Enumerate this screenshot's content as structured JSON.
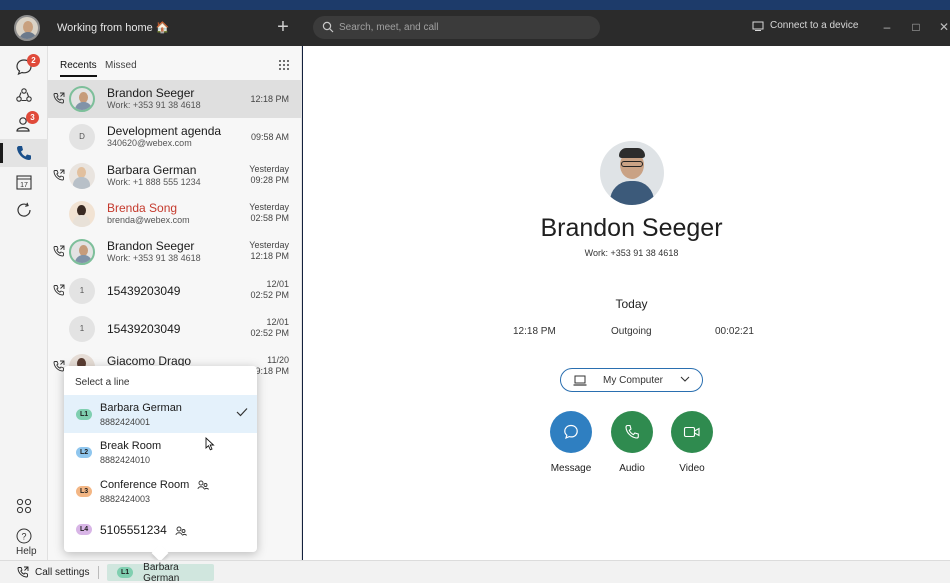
{
  "titlebar": {
    "status": "Working from home 🏠",
    "search_placeholder": "Search, meet, and call",
    "connect_label": "Connect to a device"
  },
  "rail": {
    "messaging_badge": "2",
    "contacts_badge": "3",
    "help_label": "Help"
  },
  "tabs": {
    "recents": "Recents",
    "missed": "Missed"
  },
  "calls": [
    {
      "name": "Brandon Seeger",
      "sub": "Work: +353 91 38 4618",
      "time": "12:18 PM"
    },
    {
      "name": "Development agenda",
      "sub": "340620@webex.com",
      "time": "09:58 AM",
      "initial": "D"
    },
    {
      "name": "Barbara German",
      "sub": "Work: +1 888 555 1234",
      "date": "Yesterday",
      "time": "09:28 PM"
    },
    {
      "name": "Brenda Song",
      "sub": "brenda@webex.com",
      "date": "Yesterday",
      "time": "02:58 PM"
    },
    {
      "name": "Brandon Seeger",
      "sub": "Work: +353 91 38 4618",
      "date": "Yesterday",
      "time": "12:18 PM"
    },
    {
      "name": "15439203049",
      "date": "12/01",
      "time": "02:52 PM",
      "initial": "1"
    },
    {
      "name": "15439203049",
      "date": "12/01",
      "time": "02:52 PM",
      "initial": "1"
    },
    {
      "name": "Giacomo Drago",
      "date": "11/20",
      "time": "9:18 PM"
    }
  ],
  "contact": {
    "name": "Brandon Seeger",
    "sub": "Work: +353 91 38 4618",
    "day": "Today",
    "call_time": "12:18 PM",
    "direction": "Outgoing",
    "duration": "00:02:21",
    "device": "My Computer",
    "actions": {
      "message": "Message",
      "audio": "Audio",
      "video": "Video"
    }
  },
  "popup": {
    "title": "Select a line",
    "lines": [
      {
        "chip": "L1",
        "name": "Barbara German",
        "number": "8882424001",
        "color": "#7fcfb0"
      },
      {
        "chip": "L2",
        "name": "Break Room",
        "number": "8882424010",
        "color": "#8fc6ee"
      },
      {
        "chip": "L3",
        "name": "Conference Room",
        "number": "8882424003",
        "color": "#f3b684"
      },
      {
        "chip": "L4",
        "name": "5105551234",
        "color": "#d8b5e6"
      }
    ]
  },
  "footer": {
    "call_settings": "Call settings",
    "line_chip": "L1",
    "line_name": "Barbara German"
  },
  "colors": {
    "accent_blue": "#2a6fb0",
    "message_btn": "#2f7fc1",
    "audio_btn": "#2f8b4f",
    "video_btn": "#2f8b4f",
    "missed_red": "#c53a2d"
  }
}
